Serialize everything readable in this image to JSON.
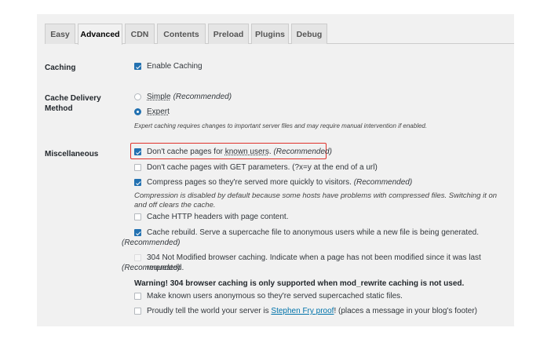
{
  "tabs": [
    {
      "label": "Easy"
    },
    {
      "label": "Advanced"
    },
    {
      "label": "CDN"
    },
    {
      "label": "Contents"
    },
    {
      "label": "Preload"
    },
    {
      "label": "Plugins"
    },
    {
      "label": "Debug"
    }
  ],
  "active_tab": "Advanced",
  "caching": {
    "label": "Caching",
    "enable_label": "Enable Caching",
    "enabled": true
  },
  "delivery": {
    "label_line1": "Cache Delivery",
    "label_line2": "Method",
    "simple_label": "Simple",
    "simple_note": "(Recommended)",
    "expert_label": "Expert",
    "selected": "Expert",
    "note": "Expert caching requires changes to important server files and may require manual intervention if enabled."
  },
  "misc": {
    "label": "Miscellaneous",
    "known_users": {
      "prefix": "Don't cache pages for ",
      "underlined": "known users",
      "suffix": ". ",
      "note": "(Recommended)",
      "checked": true
    },
    "get_params": {
      "text": "Don't cache pages with GET parameters. (?x=y at the end of a url)",
      "checked": false
    },
    "compress": {
      "text": "Compress pages so they're served more quickly to visitors. ",
      "note": "(Recommended)",
      "checked": true
    },
    "compress_note": "Compression is disabled by default because some hosts have problems with compressed files. Switching it on and off clears the cache.",
    "http_headers": {
      "text": "Cache HTTP headers with page content.",
      "checked": false
    },
    "rebuild": {
      "text": "Cache rebuild. Serve a supercache file to anonymous users while a new file is being generated.",
      "note": "(Recommended)",
      "checked": true
    },
    "not_modified": {
      "text": "304 Not Modified browser caching. Indicate when a page has not been modified since it was last requested.",
      "note": "(Recommended)",
      "checked": false
    },
    "warning": "Warning! 304 browser caching is only supported when mod_rewrite caching is not used.",
    "anonymous": {
      "text": "Make known users anonymous so they're served supercached static files.",
      "checked": false
    },
    "proud": {
      "prefix": "Proudly tell the world your server is ",
      "link": "Stephen Fry proof",
      "suffix": "! (places a message in your blog's footer)",
      "checked": false
    }
  },
  "colors": {
    "accent": "#2271b1",
    "highlight": "#e0322b",
    "panel": "#f1f1f1",
    "link": "#0073aa"
  }
}
